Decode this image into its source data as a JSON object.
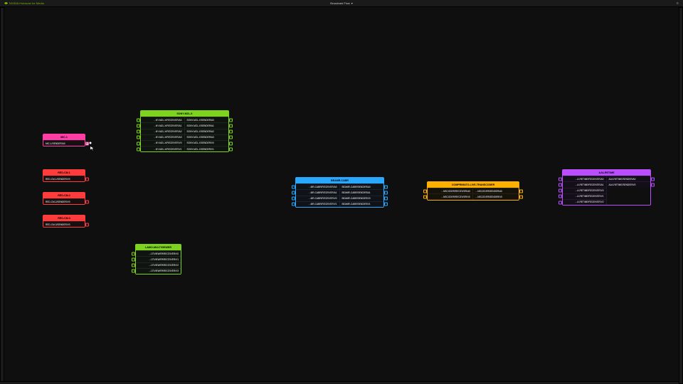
{
  "topbar": {
    "brand": "NVIDIA Holoscan for Media",
    "center": "Broadcast Flow",
    "chevron": "▾",
    "settings_icon": "gear"
  },
  "nodes": {
    "mic": {
      "title": "MIC-1",
      "out": [
        "MIC-1/SENDER/A0"
      ]
    },
    "redcm1": {
      "title": "RED-CM-1",
      "out": [
        "RED-CM-1/SENDER/V0"
      ]
    },
    "redcm2": {
      "title": "RED-CM-2",
      "out": [
        "RED-CM-2/SENDER/V0"
      ]
    },
    "redcm3": {
      "title": "RED-CM-3",
      "out": [
        "RED-CM-3/SENDER/V0"
      ]
    },
    "sony": {
      "title": "SONY-MZL-X",
      "in": [
        "…NY-MZL-X/RECEIVER/A0",
        "…NY-MZL-X/RECEIVER/A1",
        "…NY-MZL-X/RECEIVER/A2",
        "…NY-MZL-X/RECEIVER/A3",
        "…NY-MZL-X/RECEIVER/V0",
        "…NY-MZL-X/RECEIVER/V1"
      ],
      "out": [
        "SONY-MZL-X/SENDER/A0",
        "SONY-MZL-X/SENDER/A1",
        "SONY-MZL-X/SENDER/A2",
        "SONY-MZL-X/SENDER/A3",
        "SONY-MZL-X/SENDER/V0",
        "SONY-MZL-X/SENDER/V1"
      ]
    },
    "lawo": {
      "title": "LAWO-MULTIVIEWER",
      "in": [
        "…LTIVIEWER/RECEIVER/V0",
        "…LTIVIEWER/RECEIVER/V1",
        "…LTIVIEWER/RECEIVER/V2",
        "…LTIVIEWER/RECEIVER/V3"
      ]
    },
    "beamr": {
      "title": "BEAMR-CABR",
      "in": [
        "…MR-CABR/RECEIVER/A0",
        "…MR-CABR/RECEIVER/A1",
        "…MR-CABR/RECEIVER/V0",
        "…MR-CABR/RECEIVER/V1"
      ],
      "out": [
        "BEAMR-CABR/SENDER/A0",
        "BEAMR-CABR/SENDER/A1",
        "BEAMR-CABR/SENDER/V0",
        "BEAMR-CABR/SENDER/V1"
      ]
    },
    "comprimato": {
      "title": "COMPRIMATO-LIVE-TRANSCODER",
      "in": [
        "…NSCODER/RECEIVER/A0",
        "…NSCODER/RECEIVER/V0"
      ],
      "out": [
        "…NSCODER/SENDER/A0",
        "…NSCODER/SENDER/V0"
      ]
    },
    "retime": {
      "title": "AJA-RETIME",
      "in": [
        "…A-RETIME/RECEIVER/A0",
        "…A-RETIME/RECEIVER/A1",
        "…A-RETIME/RECEIVER/V0",
        "…A-RETIME/RECEIVER/V1",
        "…A-RETIME/RECEIVER/V2"
      ],
      "out": [
        "AJA-RETIME/SENDER/A0",
        "AJA-RETIME/SENDER/V0"
      ]
    }
  }
}
